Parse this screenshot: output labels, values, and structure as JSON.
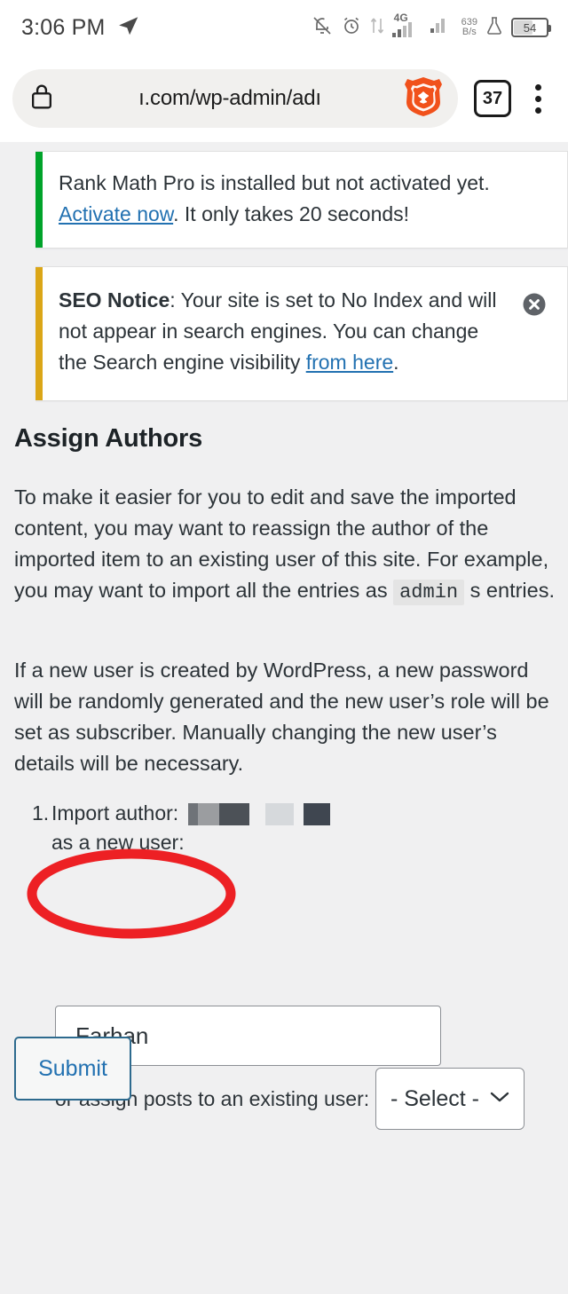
{
  "status_bar": {
    "time": "3:06 PM",
    "send_icon": "telegram-send-icon",
    "icons": [
      "notifications-off-icon",
      "alarm-clock-icon",
      "data-transfer-icon",
      "signal-4g-icon",
      "signal-bars-icon",
      "flask-icon"
    ],
    "network_label": "4G",
    "net_speed_value": "639",
    "net_speed_unit": "B/s",
    "battery_percent": "54"
  },
  "browser": {
    "lock_icon": "lock-icon",
    "url": "ı.com/wp-admin/adı",
    "brand_icon": "brave-lion-icon",
    "tab_count": "37",
    "menu_icon": "kebab-menu-icon"
  },
  "notices": [
    {
      "id": "rank-math-pro",
      "accent": "#00a32a",
      "line1": "Rank Math Pro is installed but not activated yet.",
      "link_text": "Activate now",
      "line2_rest": ". It only takes 20 seconds!",
      "dismissible": false
    },
    {
      "id": "seo-notice",
      "accent": "#dba617",
      "strong": "SEO Notice",
      "body_before": ": Your site is set to No Index and will not appear in search engines. You can change the Search engine visibility ",
      "link_text": "from here",
      "body_after": ".",
      "dismissible": true,
      "dismiss_icon": "close-circle-icon"
    }
  ],
  "main": {
    "heading": "Assign Authors",
    "paragraph_1_part_1": "To make it easier for you to edit and save the imported content, you may want to reassign the author of the imported item to an existing user of this site. For example, you may want to import all the entries as ",
    "paragraph_1_code": "admin",
    "paragraph_1_part_2": " s entries.",
    "paragraph_2": "If a new user is created by WordPress, a new password will be randomly generated and the new user’s role will be set as subscriber. Manually changing the new user’s details will be necessary.",
    "author_item": {
      "marker": "1.",
      "label_before": "Import author: ",
      "redacted_name": "[redacted]",
      "label_after": "as a new user:",
      "input_value": "Farhan",
      "input_placeholder": ""
    },
    "assign_existing_label": "or assign posts to an existing user:",
    "select_value": "- Select -",
    "select_chevron": "chevron-down-icon",
    "submit_label": "Submit"
  },
  "annotation": {
    "shape": "ellipse",
    "color": "#ED2024",
    "target": "author-name-input"
  }
}
